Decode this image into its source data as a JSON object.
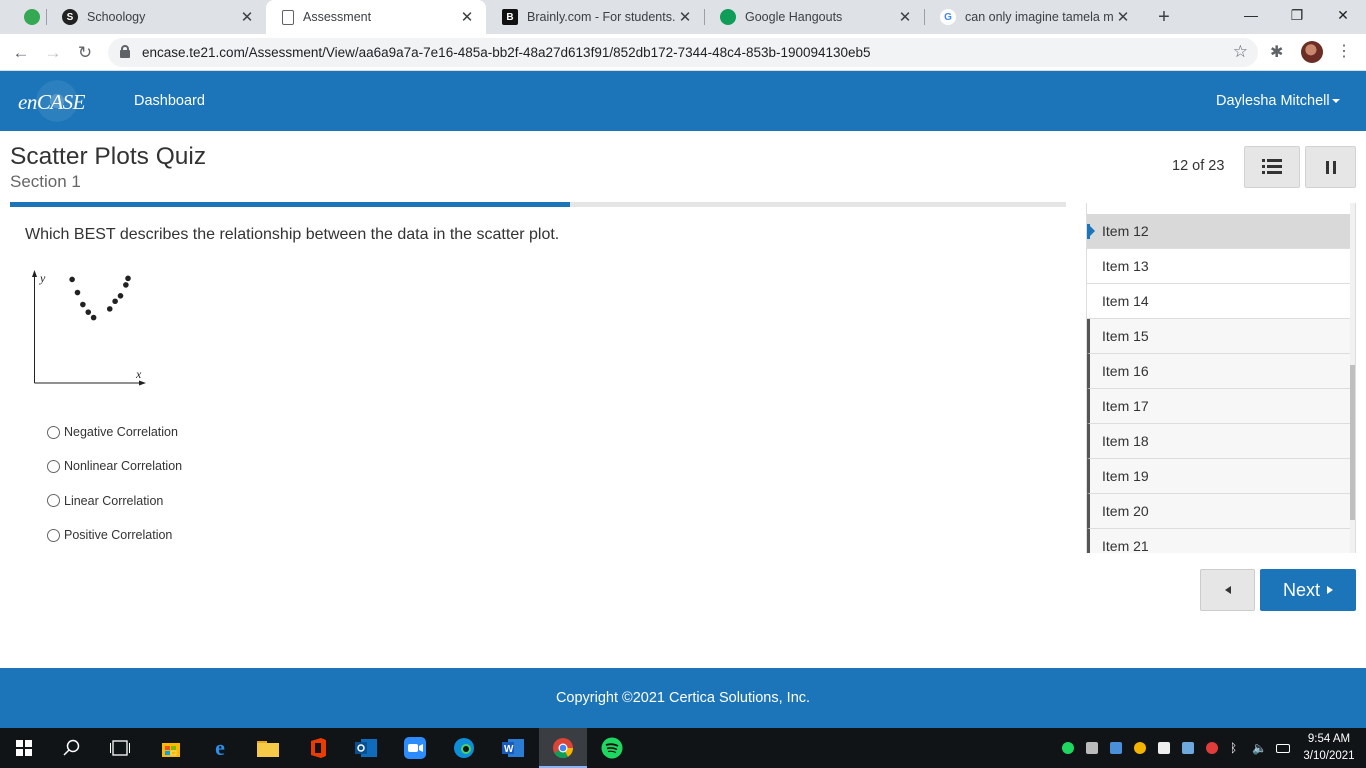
{
  "browser": {
    "tabs": [
      {
        "title": "",
        "favicon_color": "#34a853"
      },
      {
        "title": "Schoology",
        "favicon_color": "#222222",
        "favicon_text": "S"
      },
      {
        "title": "Assessment",
        "favicon_color": "#5f6368"
      },
      {
        "title": "Brainly.com - For students. By",
        "favicon_color": "#111111",
        "favicon_text": "B"
      },
      {
        "title": "Google Hangouts",
        "favicon_color": "#0f9d58"
      },
      {
        "title": "can only imagine tamela man",
        "favicon_color": "#4285f4",
        "favicon_text": "G"
      }
    ],
    "url": "encase.te21.com/Assessment/View/aa6a9a7a-7e16-485a-bb2f-48a27d613f91/852db172-7344-48c4-853b-190094130eb5"
  },
  "site": {
    "logo": "enCASE",
    "nav": {
      "dashboard": "Dashboard"
    },
    "user": "Daylesha Mitchell"
  },
  "quiz": {
    "title": "Scatter Plots Quiz",
    "section": "Section 1",
    "counter": "12 of 23",
    "progress": 0.5303,
    "question": "Which BEST describes the relationship between the data in the scatter plot.",
    "choices": [
      "Negative Correlation",
      "Nonlinear Correlation",
      "Linear Correlation",
      "Positive Correlation"
    ]
  },
  "chart_data": {
    "type": "scatter",
    "xlabel": "x",
    "ylabel": "y",
    "xlim": [
      0,
      10
    ],
    "ylim": [
      0,
      10
    ],
    "x": [
      3.5,
      4.0,
      4.5,
      5.0,
      5.5,
      7.0,
      7.5,
      8.0,
      8.5,
      8.7
    ],
    "y": [
      9.5,
      8.3,
      7.2,
      6.5,
      6.0,
      6.8,
      7.5,
      8.0,
      9.0,
      9.6
    ]
  },
  "items": {
    "current": "Item 12",
    "list": [
      "Item 12",
      "Item 13",
      "Item 14",
      "Item 15",
      "Item 16",
      "Item 17",
      "Item 18",
      "Item 19",
      "Item 20",
      "Item 21"
    ]
  },
  "nav": {
    "next": "Next"
  },
  "footer": {
    "copyright": "Copyright ©2021 Certica Solutions, Inc."
  },
  "clock": {
    "time": "9:54 AM",
    "date": "3/10/2021"
  },
  "colors": {
    "brand": "#1b75b8"
  }
}
